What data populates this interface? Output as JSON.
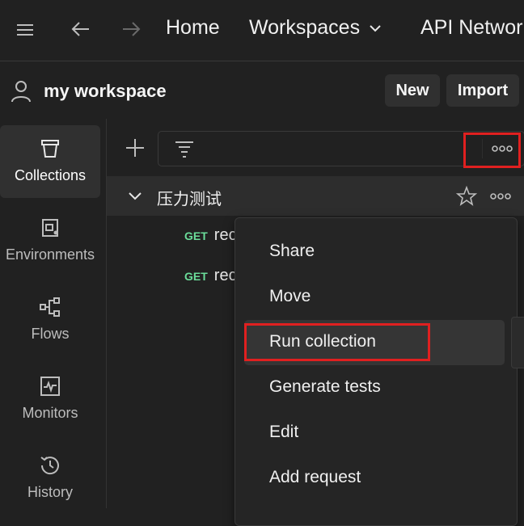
{
  "topbar": {
    "home": "Home",
    "workspaces": "Workspaces",
    "api_network": "API Network"
  },
  "workspace": {
    "name": "my workspace",
    "new_label": "New",
    "import_label": "Import"
  },
  "sidebar": {
    "items": [
      {
        "label": "Collections",
        "icon": "collections-icon",
        "active": true
      },
      {
        "label": "Environments",
        "icon": "environments-icon"
      },
      {
        "label": "Flows",
        "icon": "flows-icon"
      },
      {
        "label": "Monitors",
        "icon": "monitors-icon"
      },
      {
        "label": "History",
        "icon": "history-icon"
      }
    ]
  },
  "collection": {
    "name": "压力测试",
    "requests": [
      {
        "method": "GET",
        "name": "rec"
      },
      {
        "method": "GET",
        "name": "rec"
      }
    ]
  },
  "context_menu": {
    "items": [
      "Share",
      "Move",
      "Run collection",
      "Generate tests",
      "Edit",
      "Add request"
    ],
    "highlighted": "Run collection"
  },
  "colors": {
    "background": "#212121",
    "get_method": "#6bdd9a",
    "annotation_red": "#e02020"
  }
}
